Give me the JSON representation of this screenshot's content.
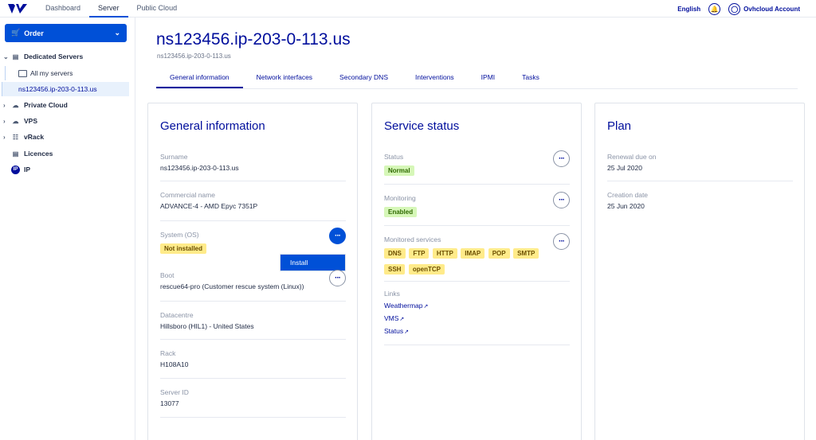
{
  "topnav": {
    "tabs": [
      "Dashboard",
      "Server",
      "Public Cloud"
    ],
    "active_tab": "Server",
    "language": "English",
    "account": "Ovhcloud Account"
  },
  "sidebar": {
    "order_label": "Order",
    "items": [
      {
        "label": "Dedicated Servers"
      },
      {
        "label": "All my servers"
      },
      {
        "label": "ns123456.ip-203-0-113.us"
      },
      {
        "label": "Private Cloud"
      },
      {
        "label": "VPS"
      },
      {
        "label": "vRack"
      },
      {
        "label": "Licences"
      },
      {
        "label": "IP"
      }
    ]
  },
  "header": {
    "title": "ns123456.ip-203-0-113.us",
    "subtitle": "ns123456.ip-203-0-113.us",
    "tabs": [
      "General information",
      "Network interfaces",
      "Secondary DNS",
      "Interventions",
      "IPMI",
      "Tasks"
    ]
  },
  "general": {
    "title": "General information",
    "surname_label": "Surname",
    "surname": "ns123456.ip-203-0-113.us",
    "commercial_label": "Commercial name",
    "commercial": "ADVANCE-4 - AMD Epyc 7351P",
    "os_label": "System (OS)",
    "os": "Not installed",
    "menu_install": "Install",
    "boot_label": "Boot",
    "boot": "rescue64-pro (Customer rescue system (Linux))",
    "datacentre_label": "Datacentre",
    "datacentre": "Hillsboro (HIL1) - United States",
    "rack_label": "Rack",
    "rack": "H108A10",
    "serverid_label": "Server ID",
    "serverid": "13077"
  },
  "service": {
    "title": "Service status",
    "status_label": "Status",
    "status": "Normal",
    "monitoring_label": "Monitoring",
    "monitoring": "Enabled",
    "monitored_label": "Monitored services",
    "services": [
      "DNS",
      "FTP",
      "HTTP",
      "IMAP",
      "POP",
      "SMTP",
      "SSH",
      "openTCP"
    ],
    "links_label": "Links",
    "links": [
      "Weathermap",
      "VMS",
      "Status"
    ]
  },
  "plan": {
    "title": "Plan",
    "renewal_label": "Renewal due on",
    "renewal": "25 Jul 2020",
    "creation_label": "Creation date",
    "creation": "25 Jun 2020"
  }
}
